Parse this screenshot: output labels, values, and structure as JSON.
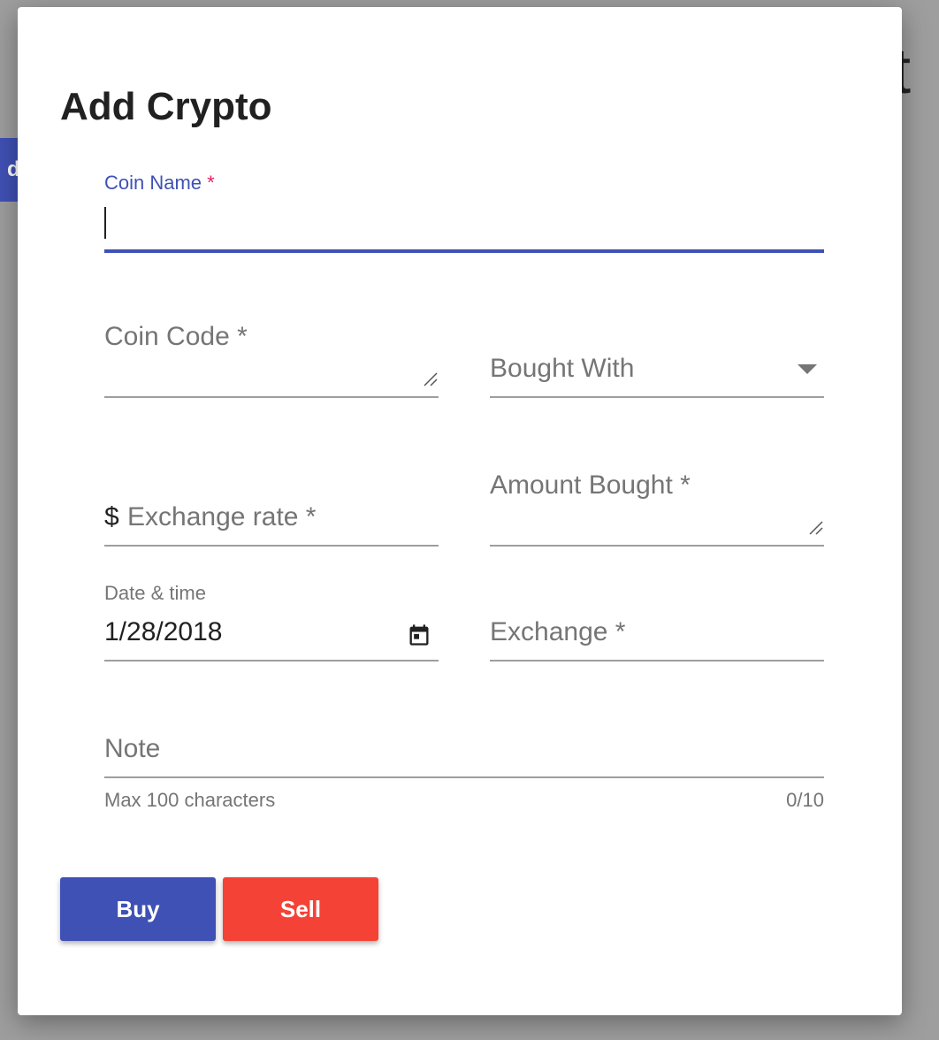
{
  "background": {
    "title_fragment": "t",
    "tab_fragment": "dc"
  },
  "dialog": {
    "title": "Add Crypto",
    "fields": {
      "coin_name": {
        "label": "Coin Name",
        "required_mark": "*",
        "value": ""
      },
      "coin_code": {
        "label": "Coin Code *"
      },
      "bought_with": {
        "label": "Bought With"
      },
      "exchange_rate": {
        "prefix": "$",
        "label": "Exchange rate *"
      },
      "amount_bought": {
        "label": "Amount Bought *"
      },
      "date_time": {
        "label": "Date & time",
        "value": "1/28/2018"
      },
      "exchange": {
        "label": "Exchange *"
      },
      "note": {
        "label": "Note",
        "helper": "Max 100 characters",
        "counter": "0/10"
      }
    },
    "buttons": {
      "buy": "Buy",
      "sell": "Sell"
    }
  },
  "colors": {
    "primary": "#3f51b5",
    "danger": "#f44336",
    "required": "#e91e63"
  },
  "icons": [
    "resize-handle-icon",
    "dropdown-arrow-icon",
    "calendar-icon"
  ]
}
